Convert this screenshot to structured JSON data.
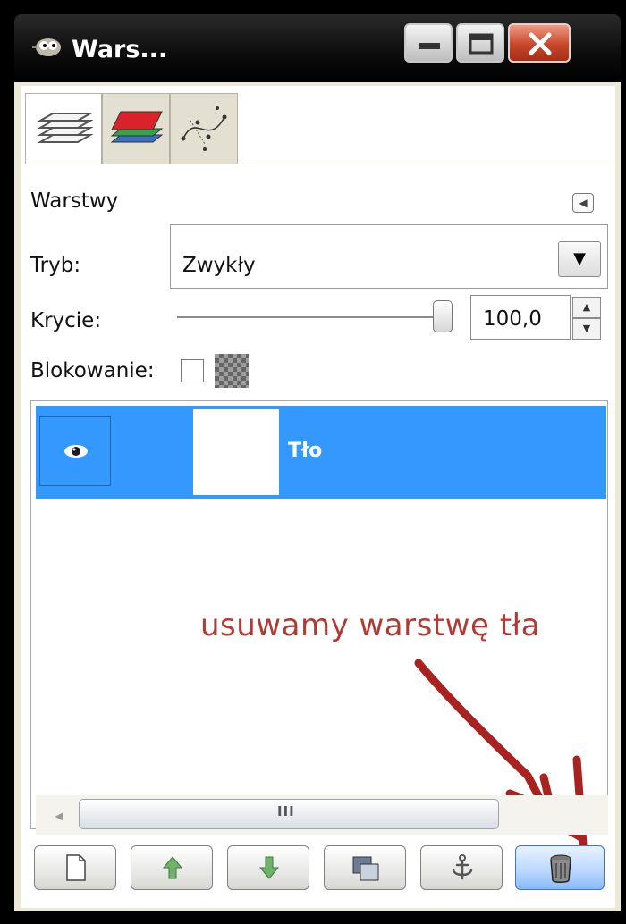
{
  "window": {
    "title": "Wars...",
    "buttons": [
      "minimize",
      "maximize",
      "close"
    ]
  },
  "tabs": [
    {
      "name": "layers",
      "icon": "layers-stack-icon",
      "selected": true
    },
    {
      "name": "channels",
      "icon": "channels-icon",
      "selected": false
    },
    {
      "name": "paths",
      "icon": "paths-icon",
      "selected": false
    }
  ],
  "dock": {
    "title": "Warstwy",
    "mode_label": "Tryb:",
    "mode_value": "Zwykły",
    "opacity_label": "Krycie:",
    "opacity_value": "100,0",
    "opacity_fraction": 1.0,
    "lock_label": "Blokowanie:",
    "lock_checked": false
  },
  "layers": [
    {
      "name": "Tło",
      "visible": true,
      "selected": true
    }
  ],
  "annotation": {
    "text": "usuwamy warstwę tła",
    "color": "#b03b35"
  },
  "scrollbar_grip": "III",
  "bottom_buttons": [
    {
      "name": "new-layer",
      "icon": "page-icon"
    },
    {
      "name": "raise-layer",
      "icon": "arrow-up-icon"
    },
    {
      "name": "lower-layer",
      "icon": "arrow-down-icon"
    },
    {
      "name": "duplicate-layer",
      "icon": "duplicate-icon"
    },
    {
      "name": "anchor-layer",
      "icon": "anchor-icon"
    },
    {
      "name": "delete-layer",
      "icon": "trash-icon",
      "highlighted": true
    }
  ],
  "colors": {
    "selection": "#3399ff",
    "titlebar": "#000000",
    "panel": "#ece9d8"
  }
}
